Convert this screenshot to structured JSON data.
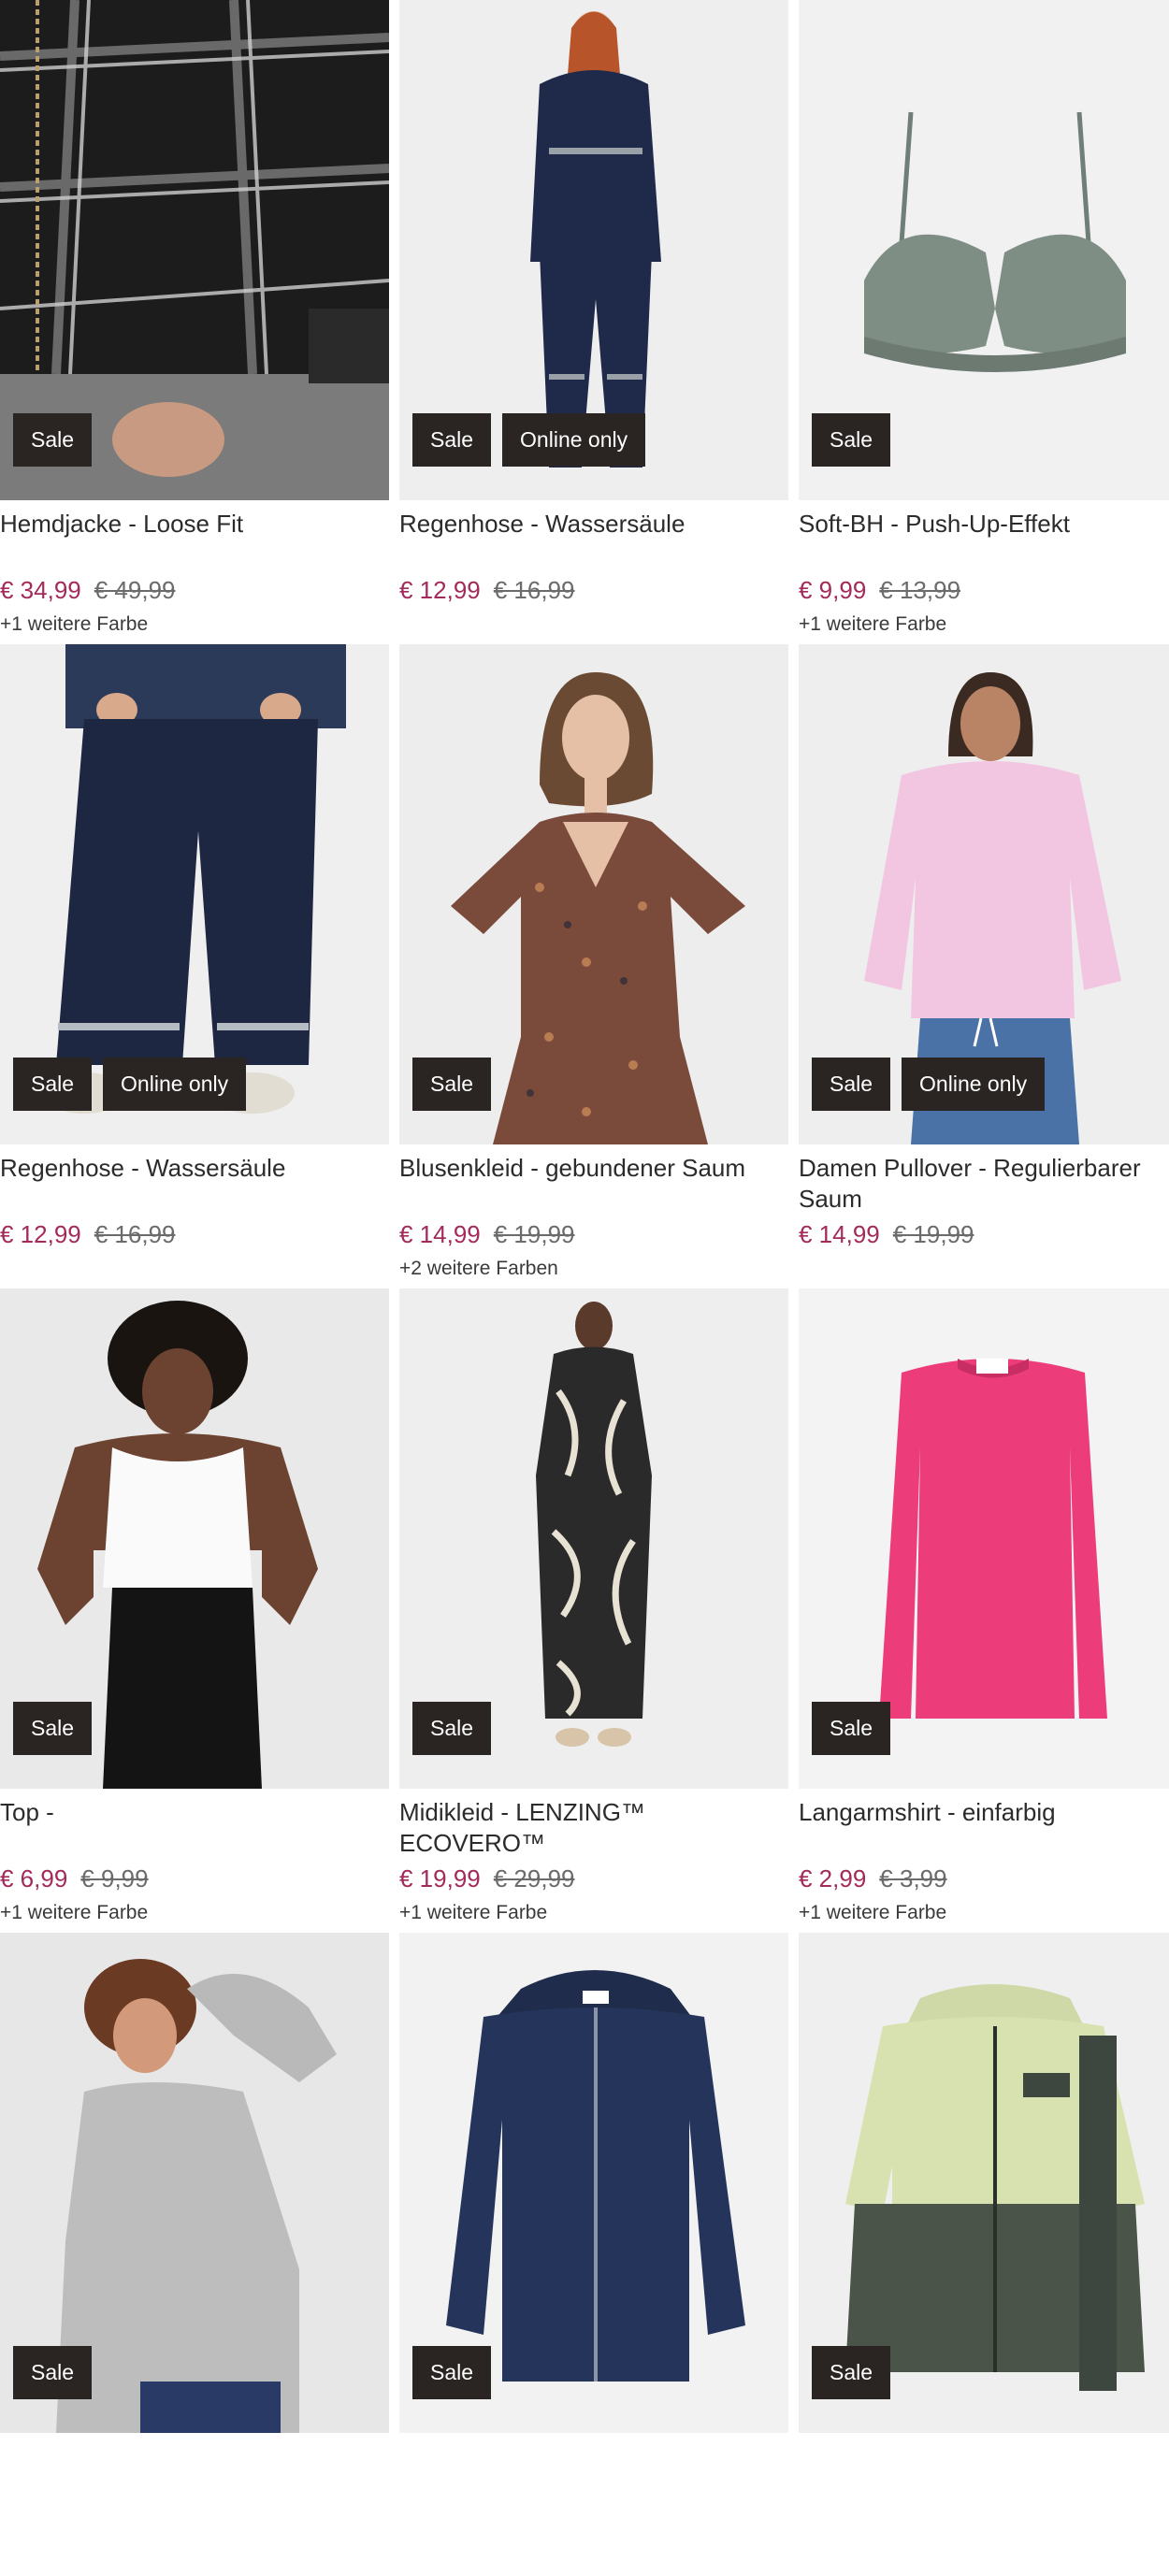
{
  "products": [
    {
      "badges": [
        "Sale"
      ],
      "title": "Hemdjacke - Loose Fit",
      "price_sale": "€ 34,99",
      "price_old": "€ 49,99",
      "more_colors": "+1 weitere Farbe",
      "image_icon": "plaid-jacket-image"
    },
    {
      "badges": [
        "Sale",
        "Online only"
      ],
      "title": "Regenhose - Wassersäule",
      "price_sale": "€ 12,99",
      "price_old": "€ 16,99",
      "more_colors": "",
      "image_icon": "rain-suit-image"
    },
    {
      "badges": [
        "Sale"
      ],
      "title": "Soft-BH - Push-Up-Effekt",
      "price_sale": "€ 9,99",
      "price_old": "€ 13,99",
      "more_colors": "+1 weitere Farbe",
      "image_icon": "bra-image"
    },
    {
      "badges": [
        "Sale",
        "Online only"
      ],
      "title": "Regenhose - Wassersäule",
      "price_sale": "€ 12,99",
      "price_old": "€ 16,99",
      "more_colors": "",
      "image_icon": "rain-pants-image"
    },
    {
      "badges": [
        "Sale"
      ],
      "title": "Blusenkleid - gebundener Saum",
      "price_sale": "€ 14,99",
      "price_old": "€ 19,99",
      "more_colors": "+2 weitere Farben",
      "image_icon": "floral-dress-image"
    },
    {
      "badges": [
        "Sale",
        "Online only"
      ],
      "title": "Damen Pullover - Regulierbarer Saum",
      "price_sale": "€ 14,99",
      "price_old": "€ 19,99",
      "more_colors": "",
      "image_icon": "pink-pullover-image"
    },
    {
      "badges": [
        "Sale"
      ],
      "title": "Top -",
      "price_sale": "€ 6,99",
      "price_old": "€ 9,99",
      "more_colors": "+1 weitere Farbe",
      "image_icon": "white-top-image"
    },
    {
      "badges": [
        "Sale"
      ],
      "title": "Midikleid - LENZING™ ECOVERO™",
      "price_sale": "€ 19,99",
      "price_old": "€ 29,99",
      "more_colors": "+1 weitere Farbe",
      "image_icon": "midi-dress-image"
    },
    {
      "badges": [
        "Sale"
      ],
      "title": "Langarmshirt - einfarbig",
      "price_sale": "€ 2,99",
      "price_old": "€ 3,99",
      "more_colors": "+1 weitere Farbe",
      "image_icon": "pink-longsleeve-image"
    },
    {
      "badges": [
        "Sale"
      ],
      "title": "",
      "price_sale": "",
      "price_old": "",
      "more_colors": "",
      "image_icon": "grey-sweater-image"
    },
    {
      "badges": [
        "Sale"
      ],
      "title": "",
      "price_sale": "",
      "price_old": "",
      "more_colors": "",
      "image_icon": "navy-hoodie-image"
    },
    {
      "badges": [
        "Sale"
      ],
      "title": "",
      "price_sale": "",
      "price_old": "",
      "more_colors": "",
      "image_icon": "kids-jacket-image"
    }
  ],
  "colors": {
    "sale_price": "#a32a5a",
    "badge_bg": "#2a2522",
    "image_bg": "#efefef"
  }
}
